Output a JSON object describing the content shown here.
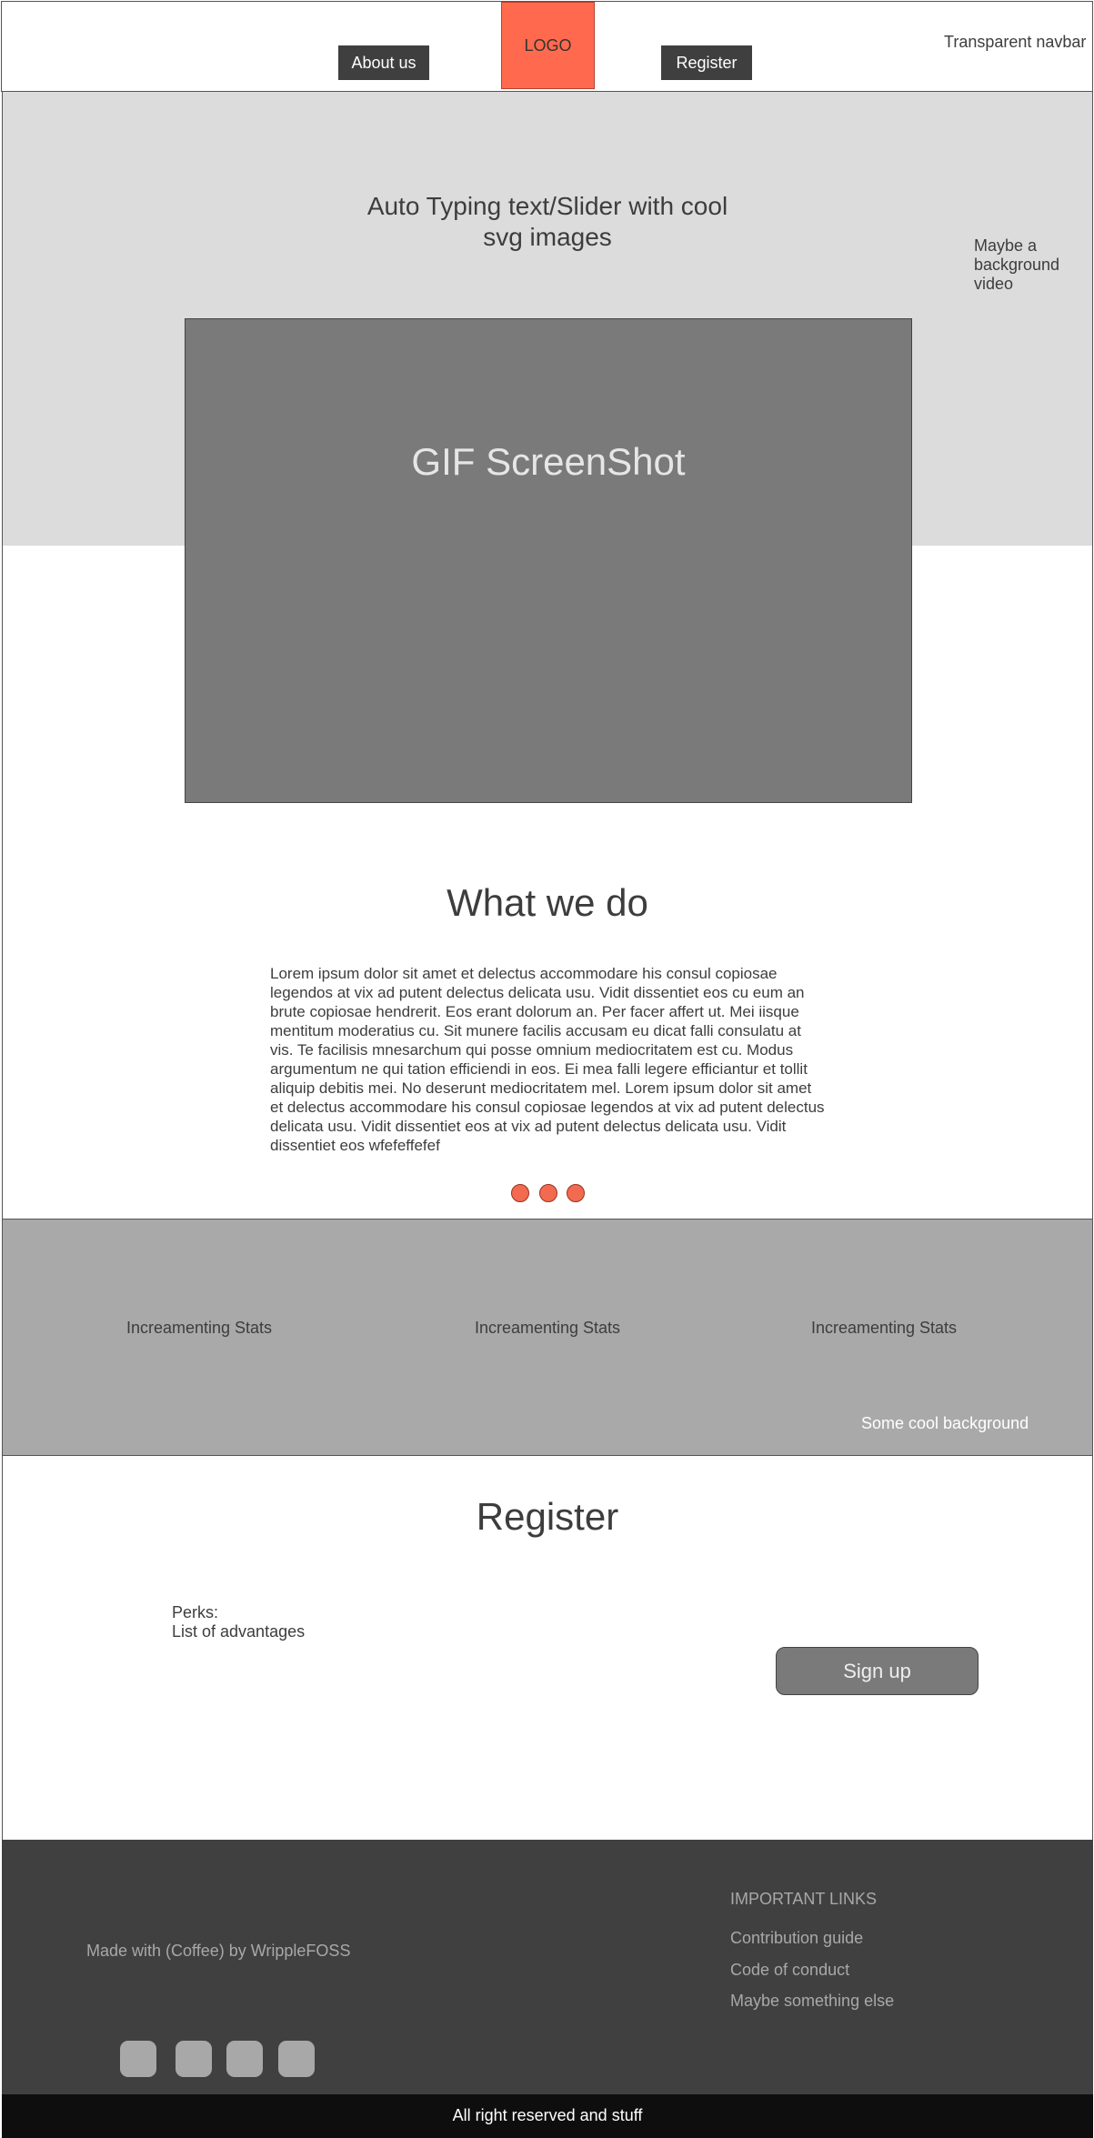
{
  "navbar": {
    "about_label": "About us",
    "logo_label": "LOGO",
    "register_label": "Register",
    "note": "Transparent navbar"
  },
  "hero": {
    "text": "Auto Typing text/Slider with cool svg images",
    "note": "Maybe a background video",
    "gif_label": "GIF ScreenShot"
  },
  "what_we_do": {
    "title": "What we do",
    "body": "Lorem ipsum dolor sit amet et delectus accommodare his consul copiosae legendos at vix ad putent delectus delicata usu. Vidit dissentiet eos cu eum an brute copiosae hendrerit. Eos erant dolorum an. Per facer affert ut. Mei iisque mentitum moderatius cu. Sit munere facilis accusam eu dicat falli consulatu at vis. Te facilisis mnesarchum qui posse omnium mediocritatem est cu. Modus argumentum ne qui tation efficiendi in eos. Ei mea falli legere efficiantur et tollit aliquip debitis mei. No deserunt mediocritatem mel. Lorem ipsum dolor sit amet et delectus accommodare his consul copiosae legendos at vix ad putent delectus delicata usu. Vidit dissentiet eos at vix ad putent delectus delicata usu. Vidit dissentiet eos wfefeffefef"
  },
  "stats": {
    "items": [
      "Increamenting Stats",
      "Increamenting Stats",
      "Increamenting Stats"
    ],
    "note": "Some cool background"
  },
  "register": {
    "title": "Register",
    "perks_label": "Perks:",
    "perks_text": "List of advantages",
    "signup_label": "Sign up"
  },
  "footer": {
    "made_with": "Made with (Coffee) by WrippleFOSS",
    "links_heading": "IMPORTANT LINKS",
    "links": [
      "Contribution guide",
      "Code of conduct",
      "Maybe something else"
    ],
    "copyright": "All right reserved and stuff"
  },
  "colors": {
    "accent": "#ff6a4f",
    "hero_bg": "#dcdcdc",
    "stats_bg": "#a9a9a9",
    "footer_bg": "#404040",
    "bottom_bar_bg": "#0e0e0e"
  }
}
